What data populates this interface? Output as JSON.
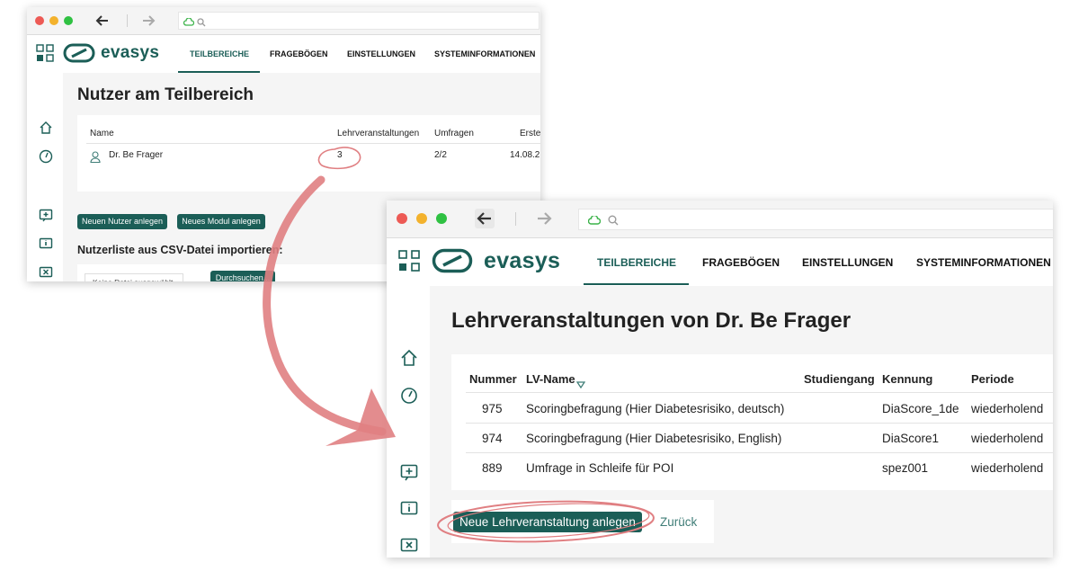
{
  "brand": {
    "logo_text": "evasys"
  },
  "nav": {
    "tabs": [
      "TEILBEREICHE",
      "FRAGEBÖGEN",
      "EINSTELLUNGEN",
      "SYSTEMINFORMATIONEN"
    ]
  },
  "back_window": {
    "page_title": "Nutzer am Teilbereich",
    "table": {
      "headers": [
        "Name",
        "Lehrveranstaltungen",
        "Umfragen",
        "Erste"
      ],
      "rows": [
        {
          "name": "Dr. Be Frager",
          "courses": "3",
          "surveys": "2/2",
          "created": "14.08.2"
        }
      ]
    },
    "buttons": {
      "new_user": "Neuen Nutzer anlegen",
      "new_module": "Neues Modul anlegen"
    },
    "import": {
      "title": "Nutzerliste aus CSV-Datei importieren:",
      "file_placeholder": "Keine Datei ausgewählt.",
      "browse": "Durchsuchen..."
    }
  },
  "front_window": {
    "page_title": "Lehrveranstaltungen von Dr. Be Frager",
    "table": {
      "headers": [
        "Nummer",
        "LV-Name",
        "Studiengang",
        "Kennung",
        "Periode"
      ],
      "rows": [
        {
          "number": "975",
          "name": "Scoringbefragung (Hier Diabetesrisiko, deutsch)",
          "program": "",
          "id": "DiaScore_1de",
          "period": "wiederholend"
        },
        {
          "number": "974",
          "name": "Scoringbefragung (Hier Diabetesrisiko, English)",
          "program": "",
          "id": "DiaScore1",
          "period": "wiederholend"
        },
        {
          "number": "889",
          "name": "Umfrage in Schleife für POI",
          "program": "",
          "id": "spez001",
          "period": "wiederholend"
        }
      ]
    },
    "buttons": {
      "new_course": "Neue Lehrveranstaltung anlegen",
      "back": "Zurück"
    }
  },
  "colors": {
    "brand": "#1b5e57",
    "annotation": "#e07f82"
  }
}
